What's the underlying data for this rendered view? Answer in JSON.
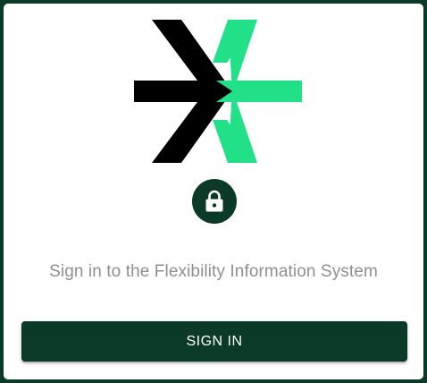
{
  "brand": {
    "logo_icon": "flexibility-logo",
    "primary_color": "#0b3a28",
    "logo_dark_color": "#000000",
    "logo_accent_color": "#22e088"
  },
  "auth": {
    "lock_icon": "lock-icon",
    "subtitle": "Sign in to the Flexibility Information System",
    "sign_in_label": "SIGN IN"
  }
}
